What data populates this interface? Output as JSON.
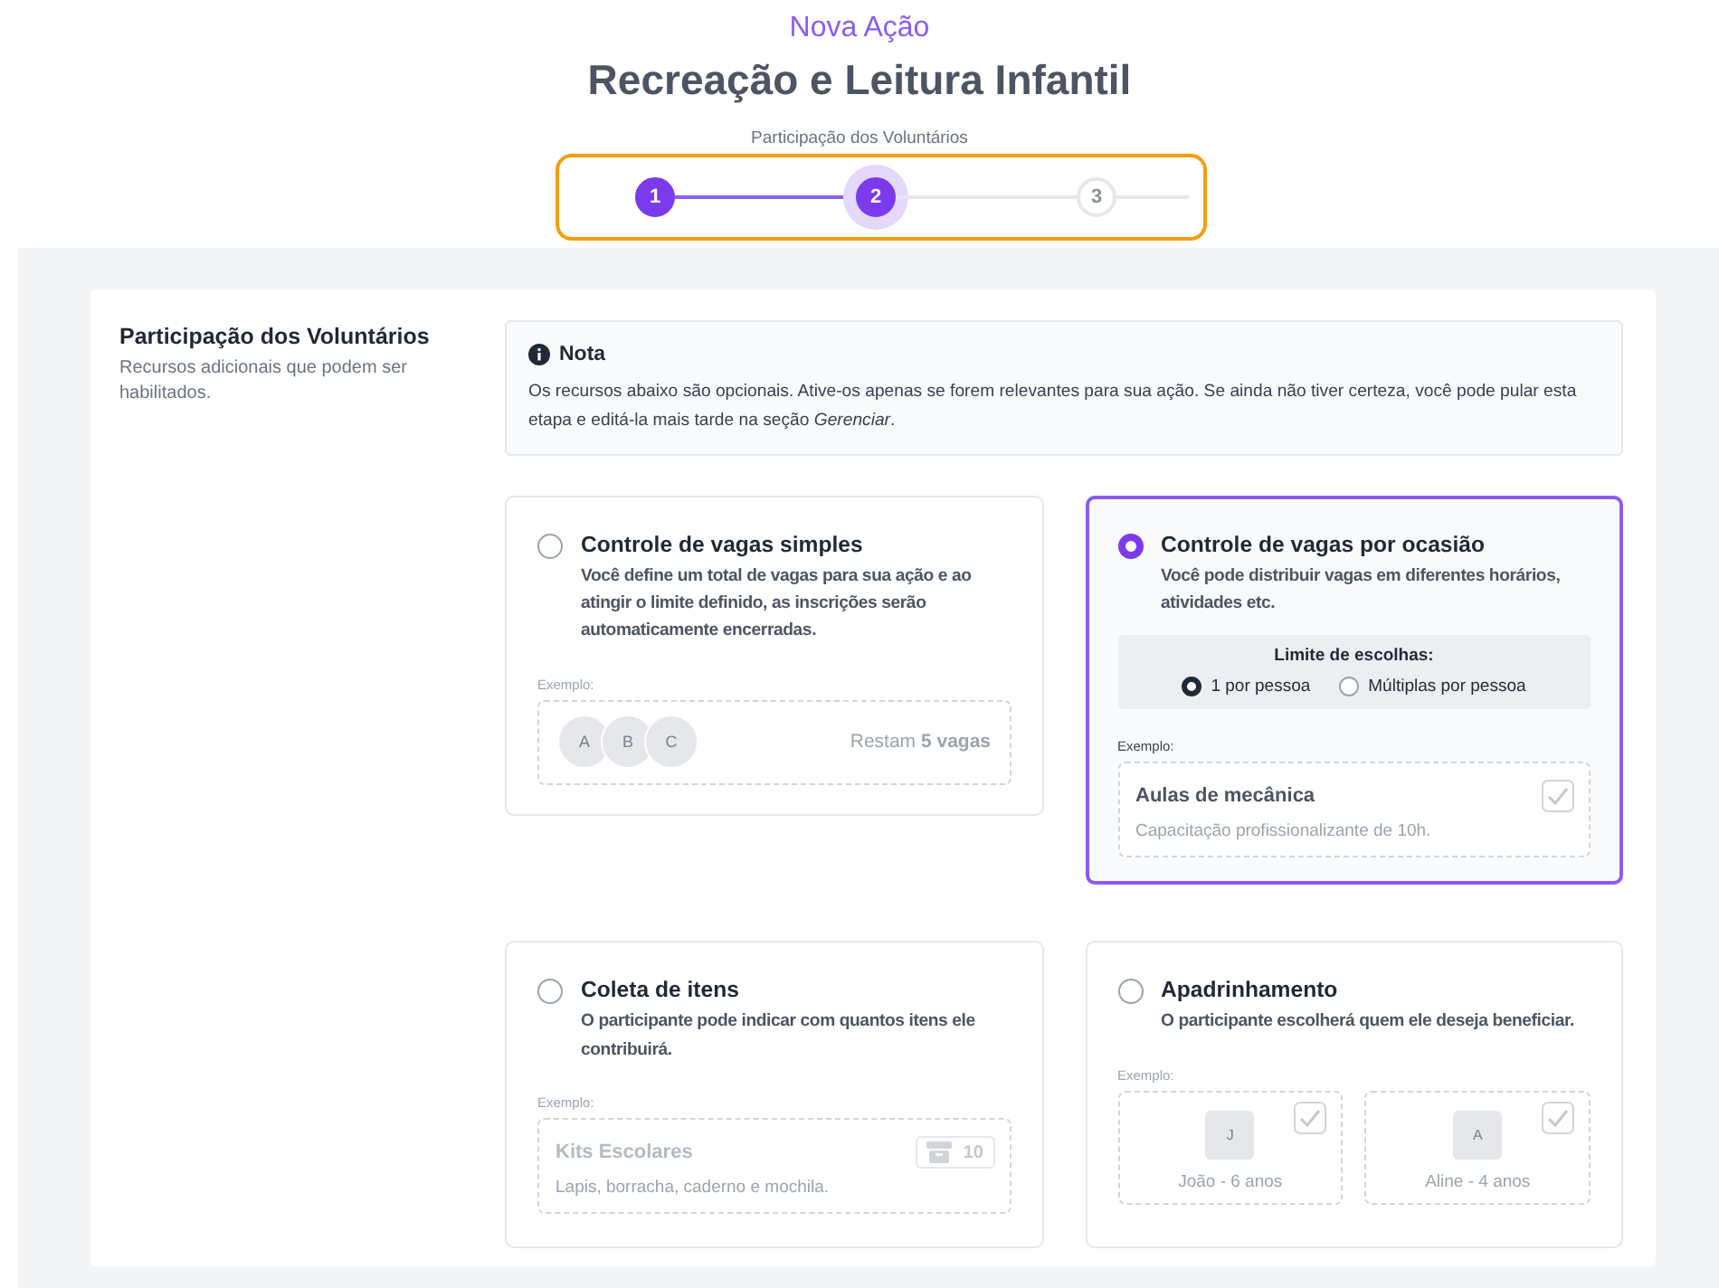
{
  "header": {
    "eyebrow": "Nova Ação",
    "title": "Recreação e Leitura Infantil"
  },
  "stepper": {
    "label": "Participação dos Voluntários",
    "steps": [
      {
        "number": "1",
        "completed": true,
        "selected": false
      },
      {
        "number": "2",
        "completed": false,
        "selected": true
      },
      {
        "number": "3",
        "completed": false,
        "selected": false
      }
    ]
  },
  "section": {
    "title": "Participação dos Voluntários",
    "description": "Recursos adicionais que podem ser habilitados."
  },
  "note": {
    "title": "Nota",
    "text": "Os recursos abaixo são opcionais. Ative-os apenas se forem relevantes para sua ação. Se ainda não tiver certeza, você pode pular esta etapa e editá-la mais tarde na seção *Gerenciar*."
  },
  "options": [
    {
      "kind": "simple",
      "selected": false,
      "title": "Controle de vagas simples",
      "description": "Você define um total de vagas para sua ação e ao atingir o limite definido, as inscrições serão automaticamente encerradas.",
      "example_label": "Exemplo:",
      "avatars": [
        "A",
        "B",
        "C"
      ],
      "remaining": "Restam **5 vagas**"
    },
    {
      "kind": "occasion",
      "selected": true,
      "title": "Controle de vagas por ocasião",
      "description": "Você pode distribuir vagas em diferentes horários, atividades etc.",
      "limit": {
        "title": "Limite de escolhas:",
        "choices": [
          {
            "label": "1 por pessoa",
            "selected": true
          },
          {
            "label": "Múltiplas por pessoa",
            "selected": false
          }
        ]
      },
      "example_label": "Exemplo:",
      "item": {
        "title": "Aulas de mecânica",
        "subtitle": "Capacitação profissionalizante de 10h.",
        "checked": true
      }
    },
    {
      "kind": "collection",
      "selected": false,
      "title": "Coleta de itens",
      "description": "O participante pode indicar com quantos itens ele contribuirá.",
      "example_label": "Exemplo:",
      "item": {
        "title": "Kits Escolares",
        "subtitle": "Lapis, borracha, caderno e mochila.",
        "count": "10"
      }
    },
    {
      "kind": "sponsorship",
      "selected": false,
      "title": "Apadrinhamento",
      "description": "O participante escolherá quem ele deseja beneficiar.",
      "example_label": "Exemplo:",
      "people": [
        {
          "initial": "J",
          "name": "João - 6 anos",
          "checked": true
        },
        {
          "initial": "A",
          "name": "Aline - 4 anos",
          "checked": true
        }
      ]
    }
  ]
}
